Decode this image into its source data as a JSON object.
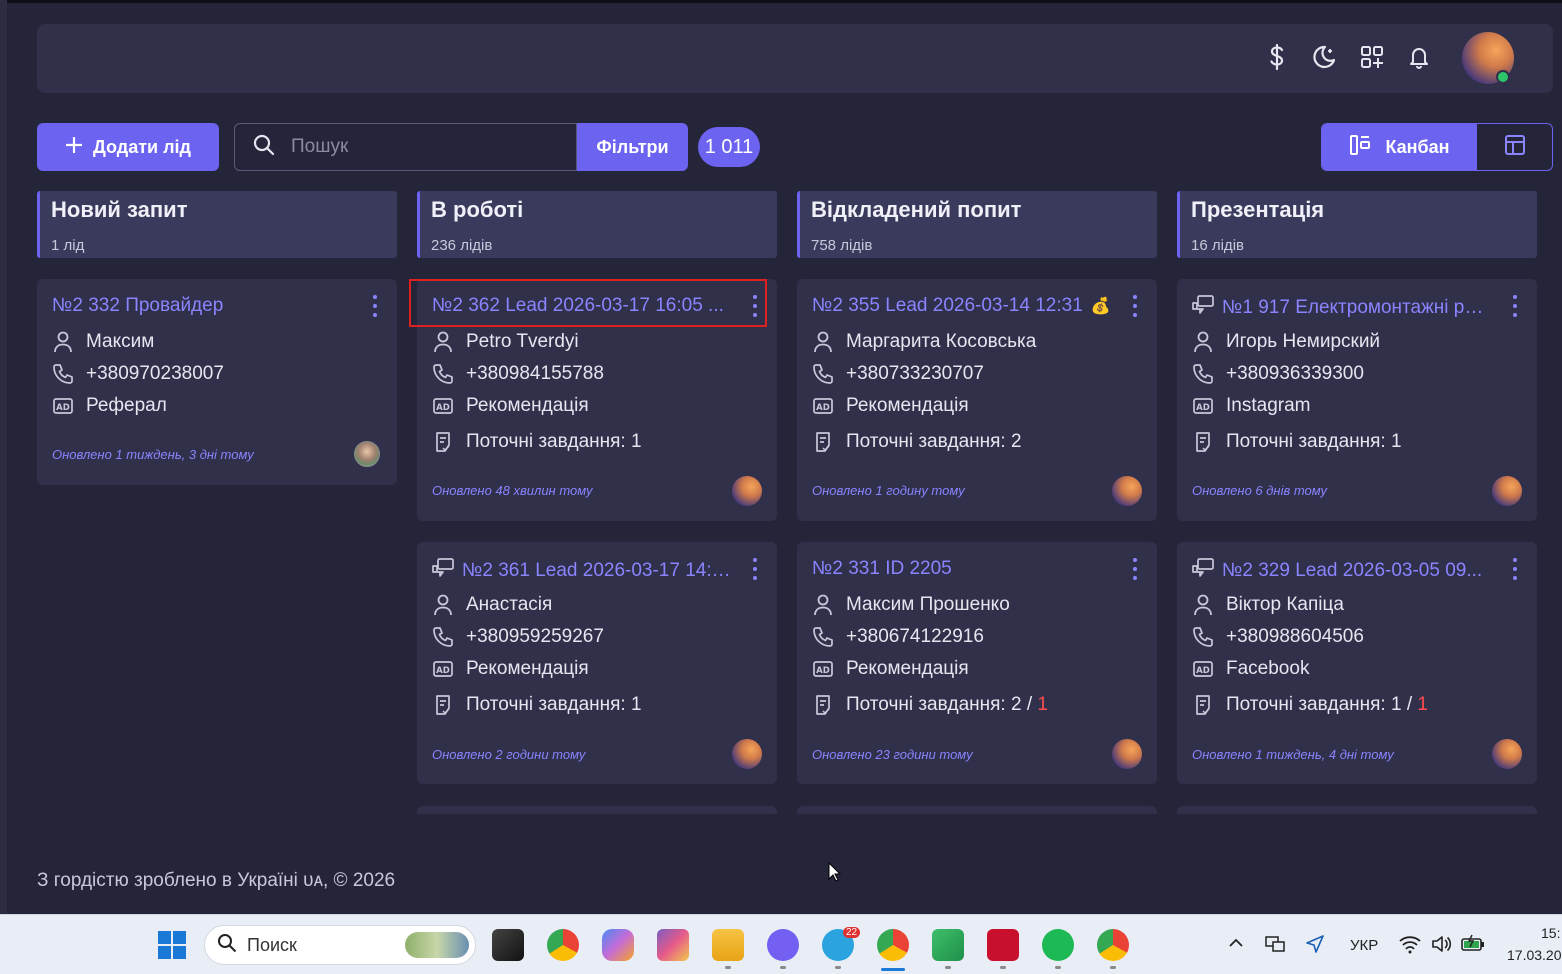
{
  "header": {
    "icons": [
      "dollar-icon",
      "theme-moon-icon",
      "apps-icon",
      "bell-icon"
    ]
  },
  "toolbar": {
    "add_label": "Додати лід",
    "search_placeholder": "Пошук",
    "filter_label": "Фільтри",
    "count": "1 011",
    "kanban_label": "Канбан"
  },
  "columns": [
    {
      "title": "Новий запит",
      "count": "1 лід"
    },
    {
      "title": "В роботі",
      "count": "236 лідів"
    },
    {
      "title": "Відкладений попит",
      "count": "758 лідів"
    },
    {
      "title": "Презентація",
      "count": "16 лідів"
    }
  ],
  "cards": {
    "c0_0": {
      "title": "№2 332 Провайдер",
      "name": "Максим",
      "phone": "+380970238007",
      "source": "Реферал",
      "updated": "Оновлено 1 тиждень, 3 дні тому"
    },
    "c1_0": {
      "title": "№2 362 Lead 2026-03-17 16:05 ...",
      "name": "Petro Tverdyi",
      "phone": "+380984155788",
      "source": "Рекомендація",
      "tasks": "Поточні завдання: 1",
      "updated": "Оновлено 48 хвилин тому"
    },
    "c1_1": {
      "title": "№2 361 Lead 2026-03-17 14:4...",
      "name": "Анастасія",
      "phone": "+380959259267",
      "source": "Рекомендація",
      "tasks": "Поточні завдання: 1",
      "updated": "Оновлено 2 години тому"
    },
    "c2_0": {
      "title": "№2 355 Lead 2026-03-14 12:31",
      "emoji": "💰",
      "name": "Маргарита Косовська",
      "phone": "+380733230707",
      "source": "Рекомендація",
      "tasks": "Поточні завдання: 2",
      "updated": "Оновлено 1 годину тому"
    },
    "c2_1": {
      "title": "№2 331 ID 2205",
      "name": "Максим Прошенко",
      "phone": "+380674122916",
      "source": "Рекомендація",
      "tasks": "Поточні завдання: 2 / ",
      "overdue": "1",
      "updated": "Оновлено 23 години тому"
    },
    "c3_0": {
      "title": "№1 917 Електромонтажні роб...",
      "name": "Игорь Немирский",
      "phone": "+380936339300",
      "source": "Instagram",
      "tasks": "Поточні завдання: 1",
      "updated": "Оновлено 6 днів тому"
    },
    "c3_1": {
      "title": "№2 329 Lead 2026-03-05 09...",
      "name": "Віктор Капіца",
      "phone": "+380988604506",
      "source": "Facebook",
      "tasks": "Поточні завдання: 1 / ",
      "overdue": "1",
      "updated": "Оновлено 1 тиждень, 4 дні тому"
    }
  },
  "footer": {
    "text": "З гордістю зроблено в Україні ᴜᴀ, © 2026"
  },
  "taskbar": {
    "search_placeholder": "Поиск",
    "lang": "УКР",
    "time": "15:",
    "date": "17.03.20",
    "telegram_badge": "22"
  },
  "colors": {
    "accent": "#6c63f0",
    "link": "#8a84ff",
    "bg": "#252539",
    "card": "#30304a",
    "danger": "#ff4d4d"
  }
}
